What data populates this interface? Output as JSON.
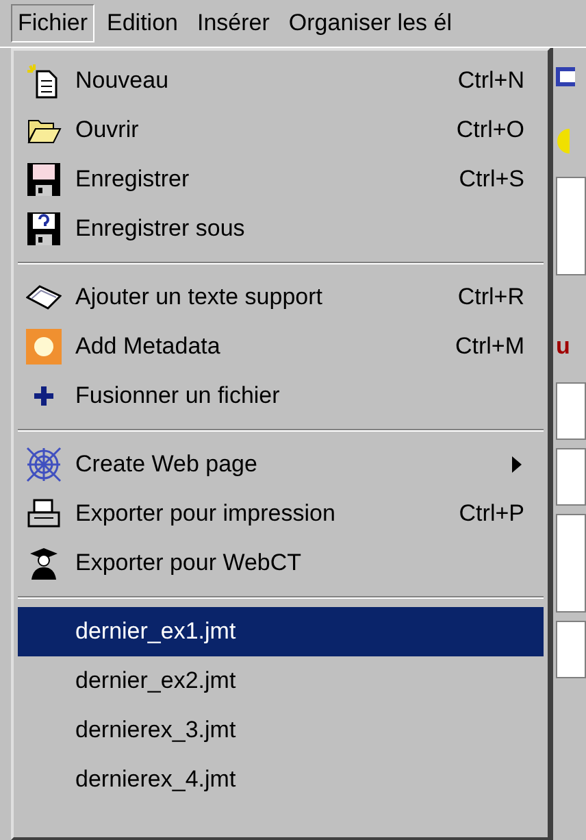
{
  "menubar": [
    {
      "label": "Fichier",
      "selected": true
    },
    {
      "label": "Edition",
      "selected": false
    },
    {
      "label": "Insérer",
      "selected": false
    },
    {
      "label": "Organiser les él",
      "selected": false
    }
  ],
  "menu": [
    {
      "kind": "item",
      "label": "Nouveau",
      "shortcut": "Ctrl+N"
    },
    {
      "kind": "item",
      "label": "Ouvrir",
      "shortcut": "Ctrl+O"
    },
    {
      "kind": "item",
      "label": "Enregistrer",
      "shortcut": "Ctrl+S"
    },
    {
      "kind": "item",
      "label": "Enregistrer sous"
    },
    {
      "kind": "separator"
    },
    {
      "kind": "item",
      "label": "Ajouter un texte support",
      "shortcut": "Ctrl+R"
    },
    {
      "kind": "item",
      "label": "Add Metadata",
      "shortcut": "Ctrl+M"
    },
    {
      "kind": "item",
      "label": "Fusionner un fichier"
    },
    {
      "kind": "separator"
    },
    {
      "kind": "item",
      "label": "Create Web page",
      "submenu": true
    },
    {
      "kind": "item",
      "label": "Exporter pour impression",
      "shortcut": "Ctrl+P"
    },
    {
      "kind": "item",
      "label": "Exporter pour WebCT"
    },
    {
      "kind": "separator"
    },
    {
      "kind": "recent",
      "label": "dernier_ex1.jmt",
      "selected": true
    },
    {
      "kind": "recent",
      "label": "dernier_ex2.jmt",
      "selected": false
    },
    {
      "kind": "recent",
      "label": "dernierex_3.jmt",
      "selected": false
    },
    {
      "kind": "recent",
      "label": "dernierex_4.jmt",
      "selected": false
    }
  ],
  "background_fragment": "u"
}
